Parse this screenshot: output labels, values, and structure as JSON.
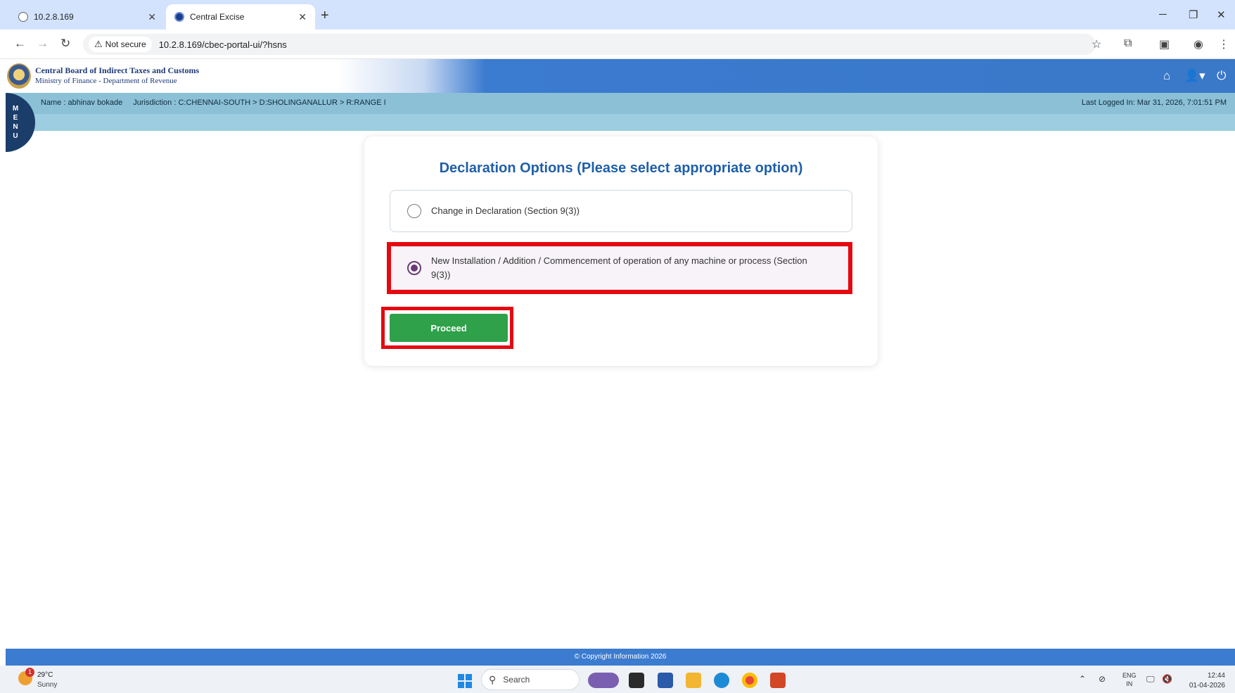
{
  "browser": {
    "tabs": [
      {
        "title": "10.2.8.169"
      },
      {
        "title": "Central Excise"
      }
    ],
    "security_label": "Not secure",
    "url": "10.2.8.169/cbec-portal-ui/?hsns"
  },
  "header": {
    "org_name": "Central Board of Indirect Taxes and Customs",
    "org_subtitle": "Ministry of Finance - Department of Revenue"
  },
  "infobar": {
    "name": "Name : abhinav bokade",
    "jurisdiction": "Jurisdiction : C:CHENNAI-SOUTH > D:SHOLINGANALLUR > R:RANGE I",
    "last_login": "Last Logged In: Mar 31, 2026, 7:01:51 PM"
  },
  "menu": {
    "letters": [
      "M",
      "E",
      "N",
      "U"
    ]
  },
  "form": {
    "title": "Declaration Options (Please select appropriate option)",
    "options": [
      {
        "label": "Change in Declaration (Section 9(3))",
        "selected": false
      },
      {
        "label": "New Installation / Addition / Commencement of operation of any machine or process (Section 9(3))",
        "selected": true
      }
    ],
    "proceed_label": "Proceed"
  },
  "footer": {
    "text": "© Copyright Information 2026"
  },
  "taskbar": {
    "weather_temp": "29°C",
    "weather_desc": "Sunny",
    "weather_badge": "1",
    "search_placeholder": "Search",
    "lang_top": "ENG",
    "lang_bottom": "IN",
    "time": "12:44",
    "date": "01-04-2026"
  },
  "colors": {
    "header_blue": "#3b7bd0",
    "title_blue": "#1f5fa8",
    "proceed_green": "#2ea14a",
    "highlight_red": "#e5090f",
    "radio_selected": "#6a3a78"
  }
}
